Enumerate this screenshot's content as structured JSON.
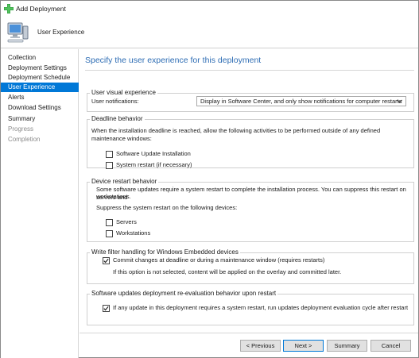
{
  "window": {
    "title": "Add Deployment"
  },
  "header": {
    "heading": "User Experience"
  },
  "sidebar": {
    "items": [
      {
        "label": "Collection"
      },
      {
        "label": "Deployment Settings"
      },
      {
        "label": "Deployment Schedule"
      },
      {
        "label": "User Experience"
      },
      {
        "label": "Alerts"
      },
      {
        "label": "Download Settings"
      },
      {
        "label": "Summary"
      },
      {
        "label": "Progress"
      },
      {
        "label": "Completion"
      }
    ],
    "selected": "User Experience"
  },
  "main": {
    "page_title": "Specify the user experience for this deployment",
    "visual": {
      "group_label": "User visual experience",
      "notifications_label": "User notifications:",
      "notifications_value": "Display in Software Center, and only show notifications for computer restarts"
    },
    "deadline": {
      "group_label": "Deadline behavior",
      "description": "When the installation deadline is reached, allow the following activities to be performed outside of any defined maintenance windows:",
      "options": [
        {
          "label": "Software Update Installation",
          "checked": false
        },
        {
          "label": "System restart (if necessary)",
          "checked": false
        }
      ]
    },
    "restart": {
      "group_label": "Device restart behavior",
      "description_1": "Some software updates require a system restart to complete the installation process. You can suppress this restart on servers and",
      "description_2": "workstations.",
      "suppress_label": "Suppress the system restart on the following devices:",
      "options": [
        {
          "label": "Servers",
          "checked": false
        },
        {
          "label": "Workstations",
          "checked": false
        }
      ]
    },
    "write_filter": {
      "group_label": "Write filter handling for Windows Embedded devices",
      "option": {
        "label": "Commit changes at deadline or during a maintenance window (requires restarts)",
        "checked": true
      },
      "note": "If this option is not selected, content will be applied on the overlay and committed later."
    },
    "reeval": {
      "group_label": "Software updates deployment re-evaluation behavior upon restart",
      "option": {
        "label": "If any update in this deployment requires a system restart, run updates deployment evaluation cycle after restart",
        "checked": true
      }
    }
  },
  "footer": {
    "previous": "< Previous",
    "next": "Next >",
    "summary": "Summary",
    "cancel": "Cancel"
  },
  "colors": {
    "accent": "#0078d7",
    "title_blue": "#2e6db4"
  }
}
